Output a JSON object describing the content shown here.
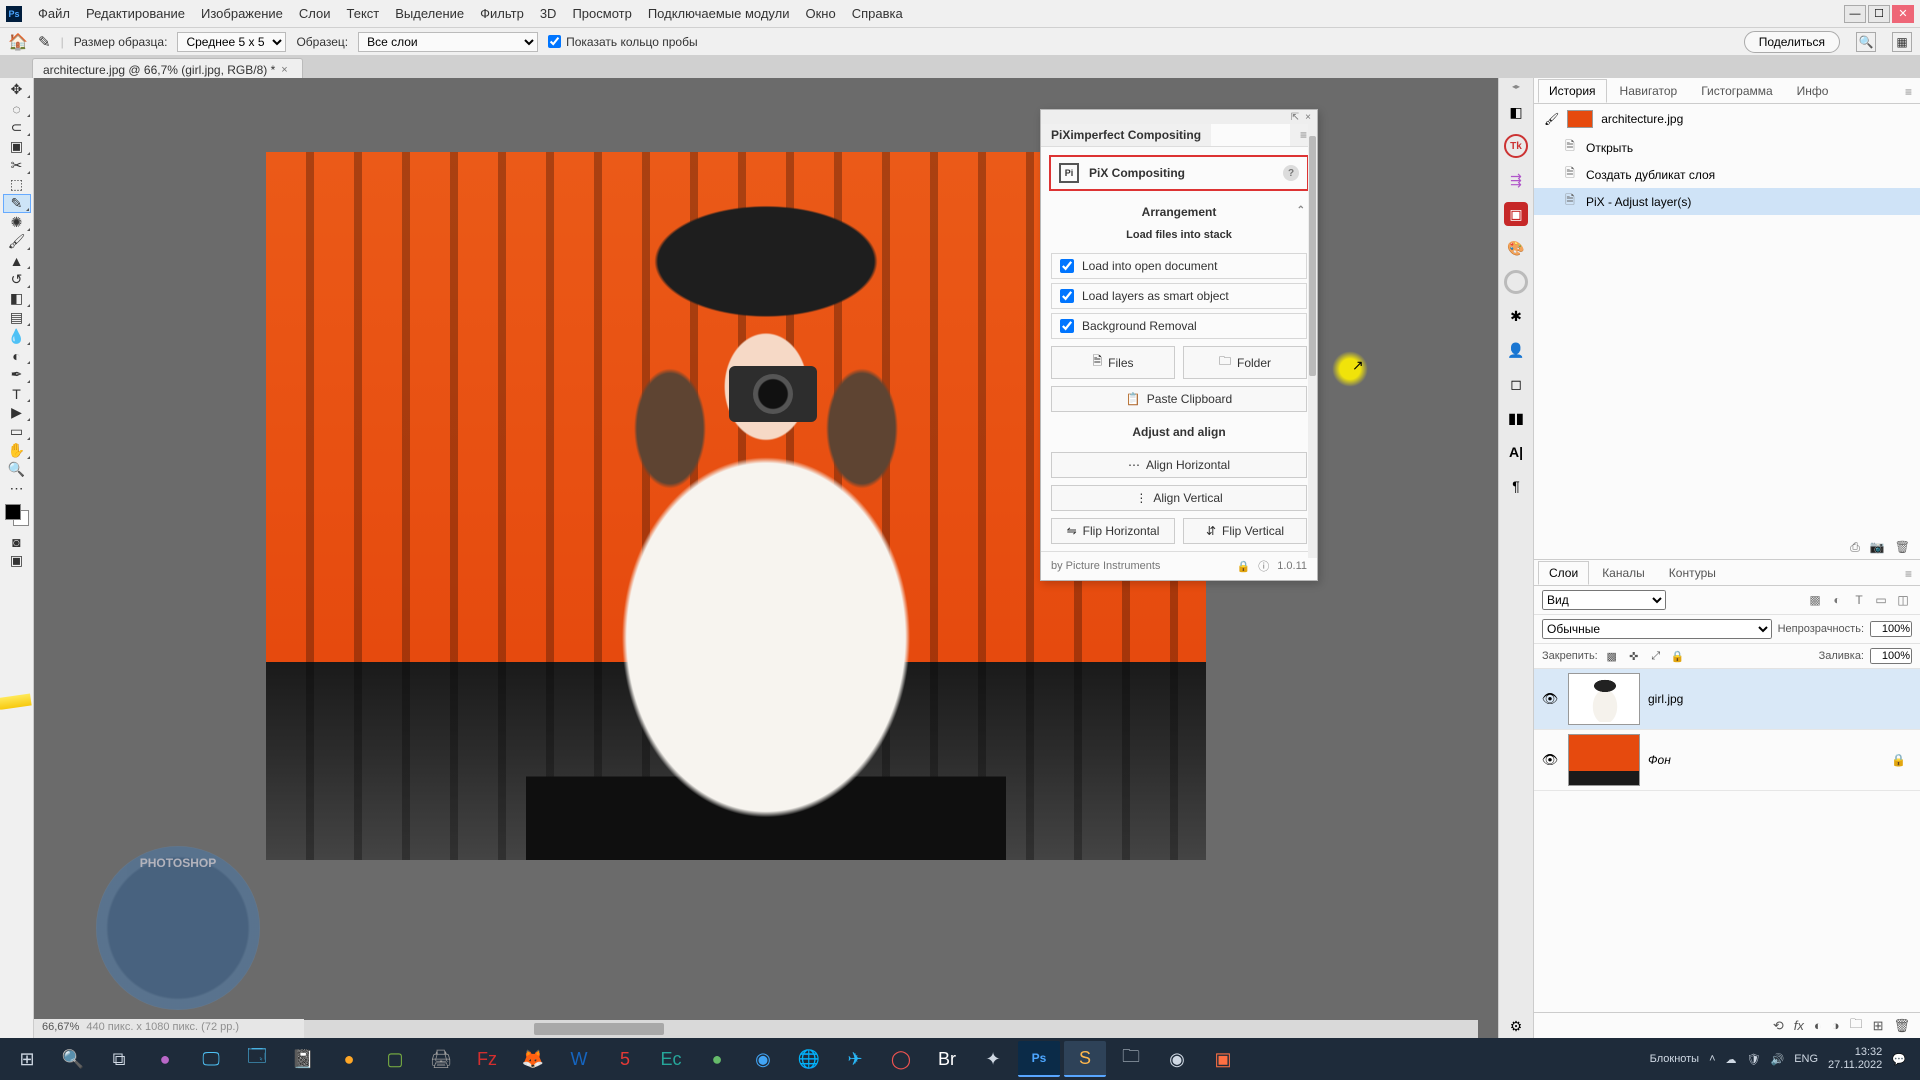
{
  "menu": {
    "items": [
      "Файл",
      "Редактирование",
      "Изображение",
      "Слои",
      "Текст",
      "Выделение",
      "Фильтр",
      "3D",
      "Просмотр",
      "Подключаемые модули",
      "Окно",
      "Справка"
    ]
  },
  "options": {
    "sample_size_label": "Размер образца:",
    "sample_size_value": "Среднее 5 x 5",
    "sample_label": "Образец:",
    "sample_scope": "Все слои",
    "show_ring": "Показать кольцо пробы",
    "share": "Поделиться"
  },
  "document": {
    "tab_title": "architecture.jpg @ 66,7% (girl.jpg, RGB/8) *"
  },
  "status": {
    "zoom": "66,67%",
    "dims": "440 пикс. x 1080 пикс. (72 pp.)"
  },
  "pix": {
    "title": "PiXimperfect Compositing",
    "btn_main": "PiX Compositing",
    "section_arrangement": "Arrangement",
    "sub_load": "Load files into stack",
    "chk_open_doc": "Load into open document",
    "chk_smart": "Load layers as smart object",
    "chk_bg_removal": "Background Removal",
    "btn_files": "Files",
    "btn_folder": "Folder",
    "btn_paste": "Paste Clipboard",
    "section_adjust": "Adjust and align",
    "btn_align_h": "Align Horizontal",
    "btn_align_v": "Align Vertical",
    "btn_flip_h": "Flip Horizontal",
    "btn_flip_v": "Flip Vertical",
    "by": "by Picture Instruments",
    "version": "1.0.11"
  },
  "right_tabs_top": {
    "t1": "История",
    "t2": "Навигатор",
    "t3": "Гистограмма",
    "t4": "Инфо"
  },
  "history": {
    "doc": "architecture.jpg",
    "rows": [
      {
        "label": "Открыть"
      },
      {
        "label": "Создать дубликат слоя"
      },
      {
        "label": "PiX - Adjust layer(s)"
      }
    ]
  },
  "right_tabs_bottom": {
    "t1": "Слои",
    "t2": "Каналы",
    "t3": "Контуры"
  },
  "layers": {
    "kind_label": "Вид",
    "blend": "Обычные",
    "opacity_label": "Непрозрачность:",
    "opacity": "100%",
    "lock_label": "Закрепить:",
    "fill_label": "Заливка:",
    "fill": "100%",
    "row1_name": "girl.jpg",
    "row2_name": "Фон"
  },
  "taskbar": {
    "tray_label": "Блокноты",
    "lang": "ENG",
    "time": "13:32",
    "date": "27.11.2022"
  },
  "watermark": "PHOTOSHOP"
}
